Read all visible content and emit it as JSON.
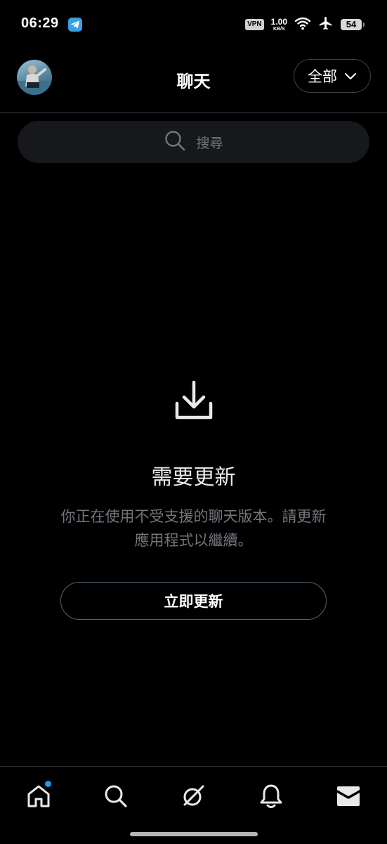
{
  "status_bar": {
    "time": "06:29",
    "vpn": "VPN",
    "net_speed_value": "1.00",
    "net_speed_unit": "KB/S",
    "battery": "54",
    "icons": [
      "telegram-icon",
      "wifi-icon",
      "airplane-icon"
    ]
  },
  "header": {
    "title": "聊天",
    "filter_label": "全部"
  },
  "search": {
    "placeholder": "搜尋"
  },
  "empty_state": {
    "title": "需要更新",
    "message": "你正在使用不受支援的聊天版本。請更新應用程式以繼續。",
    "button_label": "立即更新"
  },
  "bottom_nav": {
    "items": [
      "home",
      "search",
      "grok",
      "notifications",
      "messages"
    ],
    "active": "messages",
    "home_has_badge": true
  },
  "colors": {
    "background": "#000000",
    "accent": "#1d9bf0",
    "secondary_text": "#71767b",
    "search_bg": "#16181c"
  }
}
